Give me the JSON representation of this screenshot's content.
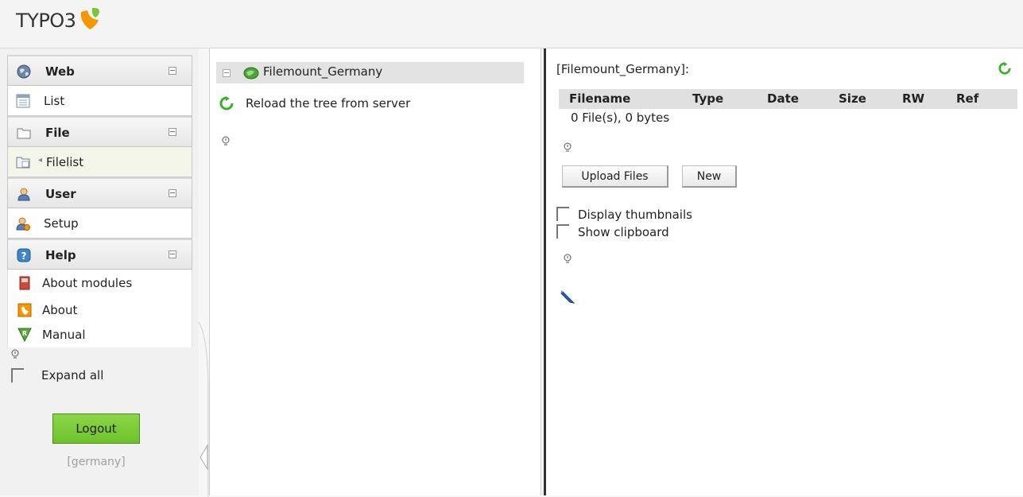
{
  "header": {
    "logo_text": "TYPO3"
  },
  "menu": {
    "groups": [
      {
        "label": "Web",
        "icon": "globe-icon",
        "items": [
          {
            "label": "List",
            "icon": "list-icon"
          }
        ]
      },
      {
        "label": "File",
        "icon": "folder-icon",
        "items": [
          {
            "label": "Filelist",
            "icon": "filelist-icon",
            "active": true
          }
        ]
      },
      {
        "label": "User",
        "icon": "user-icon",
        "items": [
          {
            "label": "Setup",
            "icon": "user-setup-icon"
          }
        ]
      },
      {
        "label": "Help",
        "icon": "help-icon",
        "items": [
          {
            "label": "About modules",
            "icon": "book-icon"
          },
          {
            "label": "About",
            "icon": "typo3-about-icon"
          },
          {
            "label": "Manual",
            "icon": "manual-icon"
          }
        ]
      }
    ],
    "expand_all_label": "Expand all",
    "logout_label": "Logout",
    "username": "[germany]"
  },
  "tree": {
    "root_label": "Filemount_Germany",
    "reload_label": "Reload the tree from server"
  },
  "filelist": {
    "path": "[Filemount_Germany]:",
    "columns": [
      "Filename",
      "Type",
      "Date",
      "Size",
      "RW",
      "Ref"
    ],
    "summary": "0 File(s), 0 bytes",
    "upload_label": "Upload Files",
    "new_label": "New",
    "display_thumbnails_label": "Display thumbnails",
    "show_clipboard_label": "Show clipboard"
  },
  "colors": {
    "accent_green": "#78c73a",
    "logo_orange": "#f49700",
    "reload_green": "#3cae2c",
    "edit_blue": "#2e63a7"
  }
}
